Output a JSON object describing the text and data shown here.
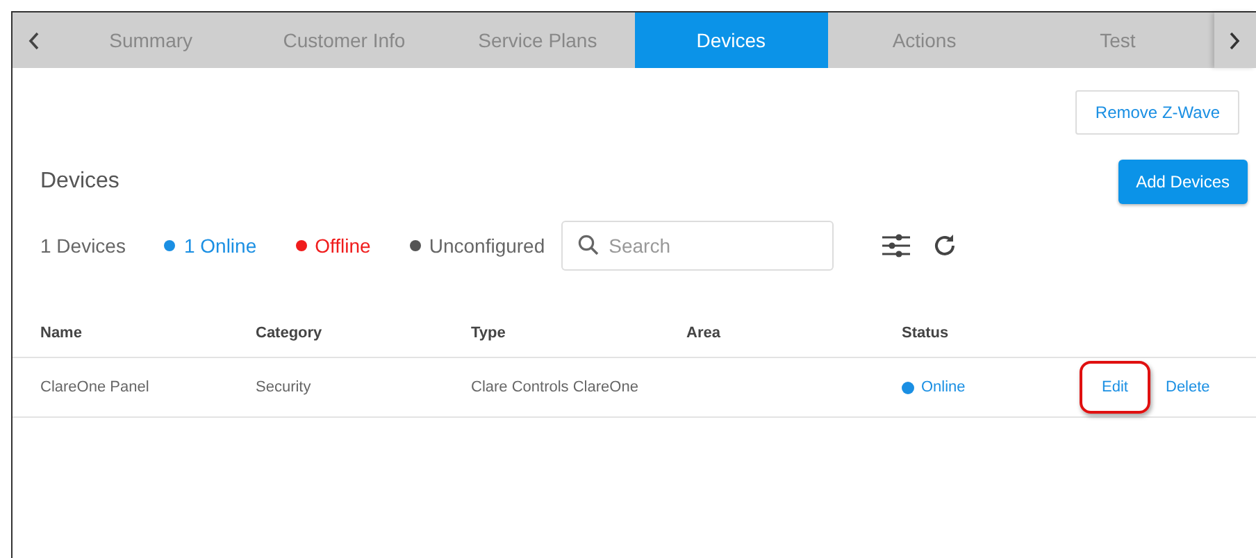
{
  "tabs": [
    {
      "label": "Summary",
      "selected": false
    },
    {
      "label": "Customer Info",
      "selected": false
    },
    {
      "label": "Service Plans",
      "selected": false
    },
    {
      "label": "Devices",
      "selected": true
    },
    {
      "label": "Actions",
      "selected": false
    },
    {
      "label": "Test",
      "selected": false
    }
  ],
  "remove_button": "Remove Z-Wave",
  "section_title": "Devices",
  "add_button": "Add Devices",
  "summary": [
    {
      "label": "1 Devices"
    },
    {
      "label": "1 Online",
      "color": "#1a8fe3"
    },
    {
      "label": "Offline",
      "color": "#f01c1c"
    },
    {
      "label": "Unconfigured",
      "color": "#555555"
    }
  ],
  "search": {
    "placeholder": "Search"
  },
  "table": {
    "columns": [
      "Name",
      "Category",
      "Type",
      "Area",
      "Status"
    ],
    "rows": [
      {
        "cells": [
          "ClareOne Panel",
          "Security",
          "Clare Controls ClareOne"
        ],
        "status": {
          "label": "Online",
          "color": "#1a8fe3"
        },
        "actions": [
          {
            "label": "Edit",
            "highlighted": true
          },
          {
            "label": "Delete",
            "highlighted": false
          }
        ]
      }
    ]
  }
}
